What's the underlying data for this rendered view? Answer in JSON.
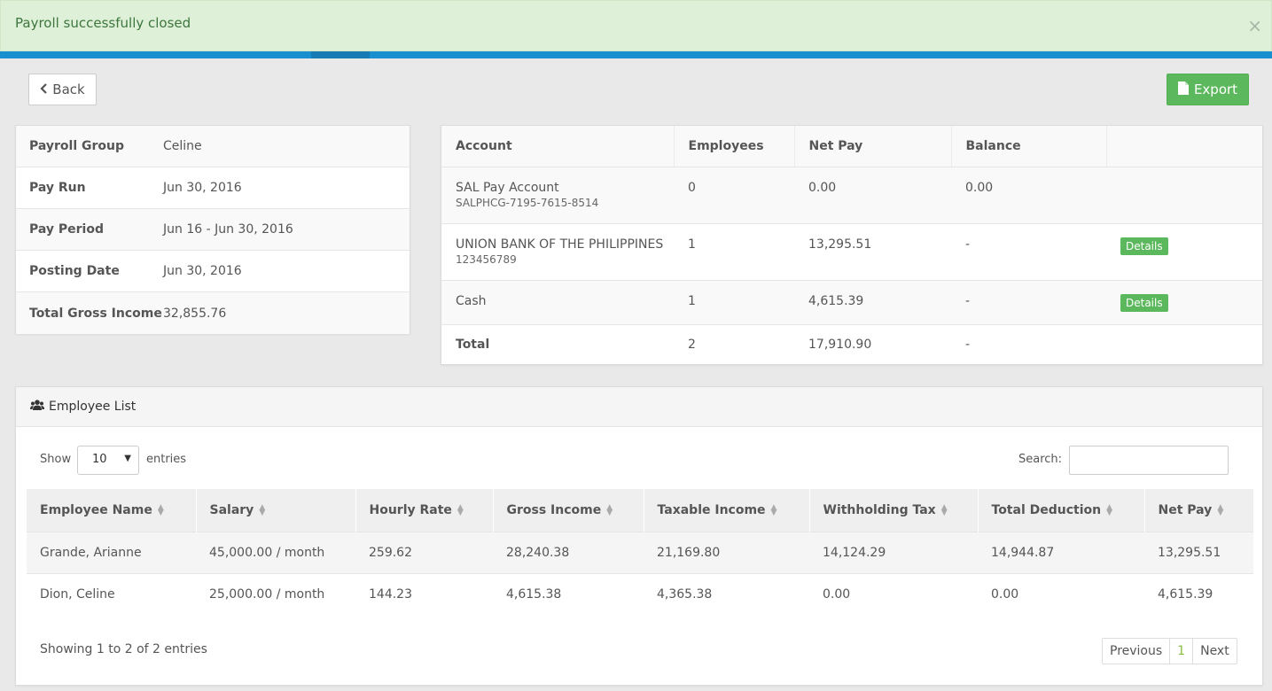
{
  "alert": {
    "message": "Payroll successfully closed",
    "close": "×"
  },
  "toolbar": {
    "back_label": "Back",
    "export_label": "Export"
  },
  "payroll_info": [
    {
      "label": "Payroll Group",
      "value": "Celine"
    },
    {
      "label": "Pay Run",
      "value": "Jun 30, 2016"
    },
    {
      "label": "Pay Period",
      "value": "Jun 16 - Jun 30, 2016"
    },
    {
      "label": "Posting Date",
      "value": "Jun 30, 2016"
    },
    {
      "label": "Total Gross Income",
      "value": "32,855.76"
    }
  ],
  "accounts": {
    "headers": [
      "Account",
      "Employees",
      "Net Pay",
      "Balance",
      ""
    ],
    "rows": [
      {
        "account": "SAL Pay Account",
        "account_no": "SALPHCG-7195-7615-8514",
        "employees": "0",
        "net_pay": "0.00",
        "balance": "0.00",
        "action": ""
      },
      {
        "account": "UNION BANK OF THE PHILIPPINES",
        "account_no": "123456789",
        "employees": "1",
        "net_pay": "13,295.51",
        "balance": "-",
        "action": "Details"
      },
      {
        "account": "Cash",
        "account_no": "",
        "employees": "1",
        "net_pay": "4,615.39",
        "balance": "-",
        "action": "Details"
      }
    ],
    "total": {
      "label": "Total",
      "employees": "2",
      "net_pay": "17,910.90",
      "balance": "-"
    }
  },
  "employee_list": {
    "title": "Employee List",
    "show_label": "Show",
    "page_size": "10",
    "entries_label": "entries",
    "search_label": "Search:",
    "search_value": "",
    "columns": [
      "Employee Name",
      "Salary",
      "Hourly Rate",
      "Gross Income",
      "Taxable Income",
      "Withholding Tax",
      "Total Deduction",
      "Net Pay"
    ],
    "rows": [
      [
        "Grande, Arianne",
        "45,000.00 / month",
        "259.62",
        "28,240.38",
        "21,169.80",
        "14,124.29",
        "14,944.87",
        "13,295.51"
      ],
      [
        "Dion, Celine",
        "25,000.00 / month",
        "144.23",
        "4,615.38",
        "4,365.38",
        "0.00",
        "0.00",
        "4,615.39"
      ]
    ],
    "info": "Showing 1 to 2 of 2 entries",
    "pager": {
      "previous": "Previous",
      "current": "1",
      "next": "Next"
    }
  },
  "colors": {
    "success": "#5cb85c",
    "alert_bg": "#dff0d8",
    "topbar": "#1a8fd0"
  }
}
